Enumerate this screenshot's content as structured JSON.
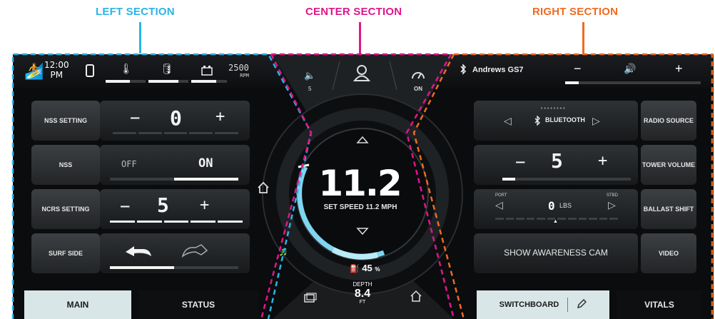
{
  "sections": {
    "left": "LEFT SECTION",
    "center": "CENTER SECTION",
    "right": "RIGHT SECTION"
  },
  "colors": {
    "left": "#2bb3e6",
    "center": "#e0168a",
    "right": "#ef6a22",
    "accent": "#7fd6f0"
  },
  "status": {
    "time": "12:00",
    "ampm": "PM",
    "rpm": "2500",
    "rpm_unit": "RPM",
    "device": "Andrews GS7"
  },
  "icons": {
    "surfer": "surfer-icon",
    "phone": "phone-icon",
    "temp": "temperature-icon",
    "oil": "oil-icon",
    "battery": "battery-icon",
    "bluetooth": "bluetooth-icon",
    "volume": "volume-icon",
    "home": "home-icon",
    "music": "music-icon",
    "fuel": "fuel-icon"
  },
  "top_controls": {
    "volume_label": "5",
    "cruise_label": "ON",
    "vol_minus": "−",
    "vol_plus": "+"
  },
  "left": {
    "nss_setting": {
      "label": "NSS SETTING",
      "value": "0",
      "minus": "−",
      "plus": "+"
    },
    "nss": {
      "label": "NSS",
      "off": "OFF",
      "on": "ON",
      "state": "on"
    },
    "ncrs": {
      "label": "NCRS SETTING",
      "value": "5",
      "minus": "−",
      "plus": "+"
    },
    "surf_side": {
      "label": "SURF SIDE"
    }
  },
  "center": {
    "speed": "11.2",
    "set_speed_label": "SET SPEED",
    "set_speed": "11.2 MPH",
    "fuel": "45",
    "fuel_unit": "%",
    "depth_label": "DEPTH",
    "depth": "8.4",
    "depth_unit": "FT"
  },
  "right": {
    "radio": {
      "label": "RADIO SOURCE",
      "source": "BLUETOOTH"
    },
    "tower": {
      "label": "TOWER VOLUME",
      "value": "5",
      "minus": "−",
      "plus": "+"
    },
    "ballast": {
      "label": "BALLAST SHIFT",
      "port": "PORT",
      "stbd": "STBD",
      "value": "0",
      "unit": "LBS"
    },
    "video": {
      "label": "VIDEO",
      "cam": "SHOW AWARENESS CAM"
    }
  },
  "tabs": {
    "main": "MAIN",
    "status": "STATUS",
    "switchboard": "SWITCHBOARD",
    "vitals": "VITALS"
  }
}
